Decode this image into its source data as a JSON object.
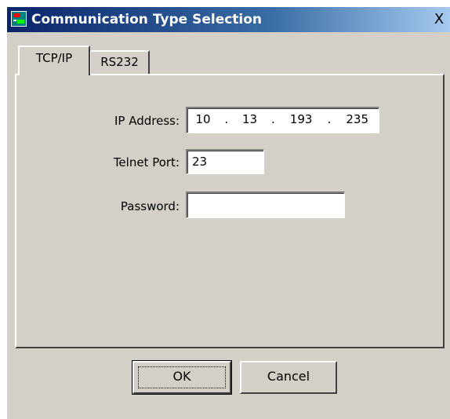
{
  "window": {
    "title": "Communication Type Selection",
    "close_label": "X"
  },
  "tabs": [
    {
      "label": "TCP/IP",
      "active": true
    },
    {
      "label": "RS232",
      "active": false
    }
  ],
  "form": {
    "ip_label": "IP Address:",
    "ip_octets": [
      "10",
      ".",
      "13",
      ".",
      "193",
      ".",
      "235"
    ],
    "port_label": "Telnet Port:",
    "port_value": "23",
    "password_label": "Password:",
    "password_value": ""
  },
  "buttons": {
    "ok": "OK",
    "cancel": "Cancel"
  },
  "colors": {
    "dialog_bg": "#d4d0c8",
    "titlebar_start": "#0a246a",
    "titlebar_end": "#a6caf0"
  }
}
